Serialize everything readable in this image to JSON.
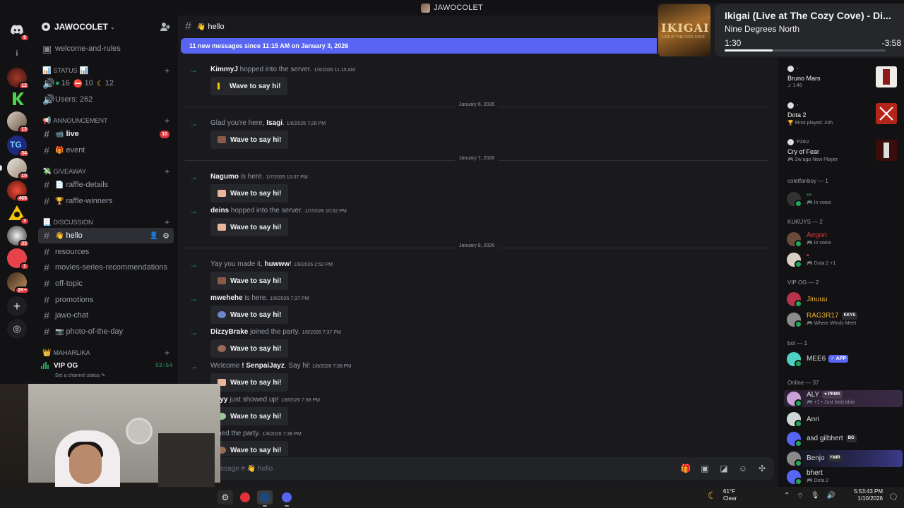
{
  "window": {
    "title": "JAWOCOLET"
  },
  "server_rail": {
    "badges": [
      "9",
      "12",
      "13",
      "34",
      "10",
      "466",
      "3",
      "33",
      "1",
      "2K+"
    ]
  },
  "guild": {
    "name": "JAWOCOLET",
    "channels": {
      "welcome": "welcome-and-rules",
      "status_cat": "STATUS",
      "status_counts": {
        "online": "16",
        "dnd": "10",
        "idle": "12"
      },
      "users": "Users: 262",
      "announcement_cat": "ANNOUNCEMENT",
      "live": "live",
      "live_badge": "10",
      "event": "event",
      "giveaway_cat": "GIVEAWAY",
      "raffle_details": "raffle-details",
      "raffle_winners": "raffle-winners",
      "discussion_cat": "DISCUSSION",
      "hello": "hello",
      "resources": "resources",
      "movies": "movies-series-recommendations",
      "offtopic": "off-topic",
      "promotions": "promotions",
      "jawochat": "jawo-chat",
      "photo": "photo-of-the-day",
      "maharlika_cat": "MAHARLIKA",
      "vip_og": "VIP OG",
      "vip_time": "53:54",
      "vip_status": "Set a channel status"
    }
  },
  "chat": {
    "channel": "hello",
    "new_messages": "11 new messages since 11:15 AM on January 3, 2026",
    "dividers": [
      "January 6, 2026",
      "January 7, 2026",
      "January 8, 2026"
    ],
    "messages": [
      {
        "pre": "",
        "user": "KimmyJ",
        "post": " hopped into the server.",
        "ts": "1/3/2026 11:15 AM",
        "wave": "Wave to say hi!"
      },
      {
        "pre": "Glad you're here, ",
        "user": "Isagi",
        "post": ".",
        "ts": "1/6/2026 7:28 PM",
        "wave": "Wave to say hi!"
      },
      {
        "pre": "",
        "user": "Nagumo",
        "post": " is here.",
        "ts": "1/7/2026 10:07 PM",
        "wave": "Wave to say hi!"
      },
      {
        "pre": "",
        "user": "deins",
        "post": " hopped into the server.",
        "ts": "1/7/2026 10:52 PM",
        "wave": "Wave to say hi!"
      },
      {
        "pre": "Yay you made it, ",
        "user": "huwww",
        "post": "!",
        "ts": "1/8/2026 2:52 PM",
        "wave": "Wave to say hi!"
      },
      {
        "pre": "",
        "user": "mwehehe",
        "post": " is here.",
        "ts": "1/8/2026 7:37 PM",
        "wave": "Wave to say hi!"
      },
      {
        "pre": "",
        "user": "DizzyBrake",
        "post": " joined the party.",
        "ts": "1/8/2026 7:37 PM",
        "wave": "Wave to say hi!"
      },
      {
        "pre": "Welcome ",
        "user": "! SenpaiJayz",
        "post": ". Say hi!",
        "ts": "1/8/2026 7:38 PM",
        "wave": "Wave to say hi!"
      },
      {
        "pre": "",
        "user": "wyyy",
        "post": " just showed up!",
        "ts": "1/8/2026 7:38 PM",
        "wave": "Wave to say hi!"
      },
      {
        "pre": "",
        "user": "",
        "post": "joined the party.",
        "ts": "1/8/2026 7:38 PM",
        "wave": "Wave to say hi!"
      }
    ],
    "composer_placeholder": "ssage # 👋 hello"
  },
  "now_playing": {
    "art_text": "IKIGAI",
    "art_sub": "LIVE AT THE COZY COVE",
    "title": "Ikigai (Live at The Cozy Cove) - Di...",
    "artist": "Nine Degrees North",
    "current": "1:30",
    "remaining": "-3:58",
    "progress_fraction": 0.3
  },
  "members": {
    "activities": [
      {
        "title": "Bruno Mars",
        "sub": "1:46"
      },
      {
        "title": "Dota 2",
        "sub": "Most played: 43h"
      },
      {
        "small": "P3rkz",
        "title": "Cry of Fear",
        "sub": "2w ago  New Player"
      }
    ],
    "groups": {
      "coletfanboy": "coletfanboy — 1",
      "kukuys": "KUKUYS — 2",
      "vipog": "VIP OG — 2",
      "bot": "bot — 1",
      "online": "Online — 37"
    },
    "rows": {
      "r1_sub": "In voice",
      "r2_name": "Aegon",
      "r2_sub": "In voice",
      "r3_sub": "Dota 2 +1",
      "r4_name": "Jinuuu",
      "r5_name": "RAG3R17",
      "r5_tag": "KKYS",
      "r5_sub": "Where Winds Meet",
      "r6_name": "MEE6",
      "r6_tag": "APP",
      "r7_name": "ALY",
      "r7_tag": "PRMK",
      "r7_sub": "+1 • Just blob blob",
      "r8_name": "Anri",
      "r9_name": "asd gilbhert",
      "r9_tag": "BG",
      "r10_name": "Benjo",
      "r10_tag": "YMIR",
      "r11_name": "bhert",
      "r11_sub": "Dota 2"
    }
  },
  "taskbar": {
    "temp": "61°F",
    "weather": "Clear",
    "time": "5:53:43 PM",
    "date": "1/10/2026"
  },
  "colors": {
    "accent": "#5865f2",
    "online": "#23a55a",
    "badge": "#da373c"
  }
}
